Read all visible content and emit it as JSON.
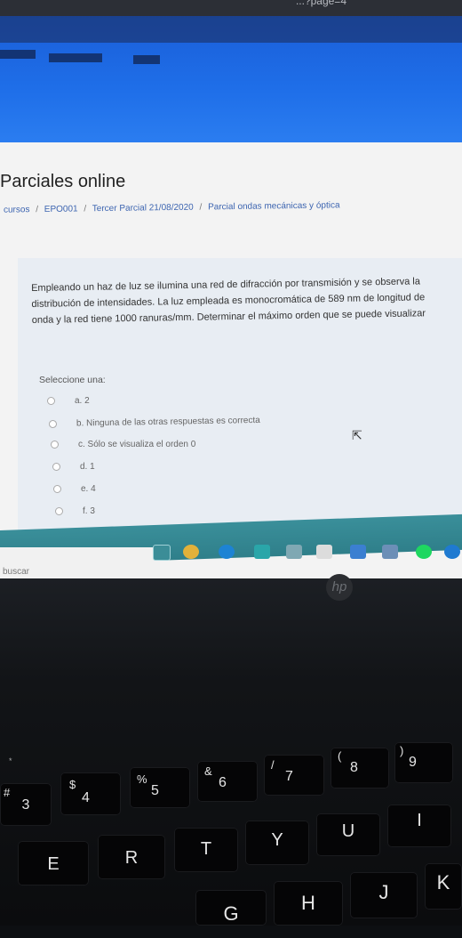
{
  "browser": {
    "url_fragment": "...?page=4"
  },
  "page": {
    "title": "Parciales online",
    "breadcrumb": [
      "cursos",
      "EPO001",
      "Tercer Parcial 21/08/2020",
      "Parcial ondas mecánicas y óptica"
    ],
    "breadcrumb_sep": "/"
  },
  "question": {
    "text": "Empleando un haz de luz se ilumina una red de difracción por transmisión y se observa la distribución de intensidades. La luz empleada es monocromática de 589 nm de longitud de onda y la red tiene 1000 ranuras/mm. Determinar el máximo orden que se puede visualizar",
    "prompt": "Seleccione una:",
    "options": [
      "a. 2",
      "b. Ninguna de las otras respuestas es correcta",
      "c. Sólo se visualiza el orden 0",
      "d. 1",
      "e. 4",
      "f. 3"
    ]
  },
  "taskbar": {
    "search_placeholder": "buscar"
  },
  "laptop": {
    "logo": "hp",
    "keys": [
      "3",
      "$",
      "4",
      "%",
      "5",
      "&",
      "6",
      "/",
      "7",
      "(",
      "8",
      ")",
      "9",
      "E",
      "R",
      "T",
      "Y",
      "U",
      "I",
      "G",
      "H",
      "J",
      "K",
      "#",
      "*"
    ]
  },
  "colors": {
    "banner": "#1f6fe9",
    "link": "#3c64b0",
    "taskbar": "#2f7f8a"
  }
}
